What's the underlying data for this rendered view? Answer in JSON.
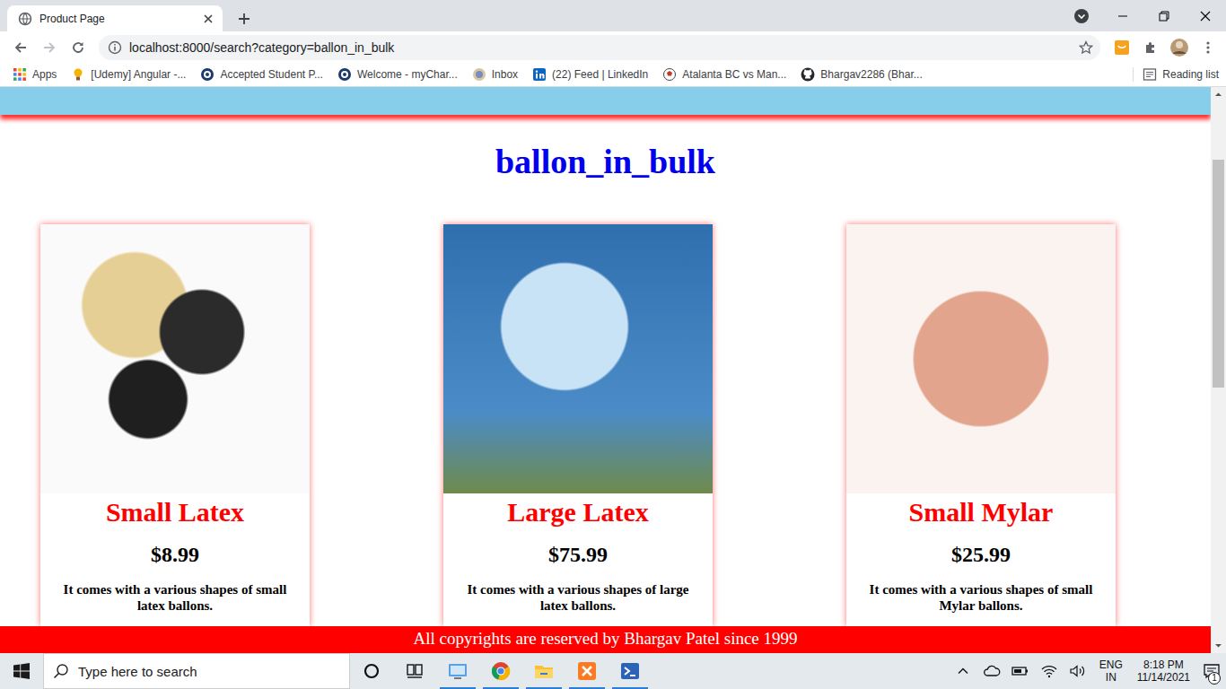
{
  "window": {
    "tabs": [
      {
        "title": "Product Page",
        "selected": true
      }
    ]
  },
  "address_bar": {
    "url": "localhost:8000/search?category=ballon_in_bulk"
  },
  "bookmarks": {
    "items": [
      {
        "label": "Apps",
        "kind": "apps"
      },
      {
        "label": "[Udemy] Angular -...",
        "kind": "udemy"
      },
      {
        "label": "Accepted Student P...",
        "kind": "badge"
      },
      {
        "label": "Welcome - myChar...",
        "kind": "badge"
      },
      {
        "label": "Inbox",
        "kind": "mail"
      },
      {
        "label": "(22) Feed | LinkedIn",
        "kind": "linkedin"
      },
      {
        "label": "Atalanta BC vs Man...",
        "kind": "ball"
      },
      {
        "label": "Bhargav2286 (Bhar...",
        "kind": "github"
      }
    ],
    "reading_list": "Reading list"
  },
  "page": {
    "heading": "ballon_in_bulk",
    "products": [
      {
        "name": "Small Latex",
        "price": "$8.99",
        "description": "It comes with a various shapes of small latex ballons."
      },
      {
        "name": "Large Latex",
        "price": "$75.99",
        "description": "It comes with a various shapes of large latex ballons."
      },
      {
        "name": "Small Mylar",
        "price": "$25.99",
        "description": "It comes with a various shapes of small Mylar ballons."
      }
    ],
    "footer": "All copyrights are reserved by Bhargav Patel since 1999"
  },
  "taskbar": {
    "search": {
      "placeholder": "Type here to search"
    },
    "apps": [
      {
        "kind": "explorer",
        "running": true
      },
      {
        "kind": "chrome",
        "running": true
      },
      {
        "kind": "folder",
        "running": true
      },
      {
        "kind": "xampp",
        "running": true
      },
      {
        "kind": "terminal",
        "running": true
      }
    ],
    "tray": {
      "language": "ENG",
      "region": "IN",
      "time": "8:18 PM",
      "date": "11/14/2021",
      "notifications": "1"
    }
  }
}
